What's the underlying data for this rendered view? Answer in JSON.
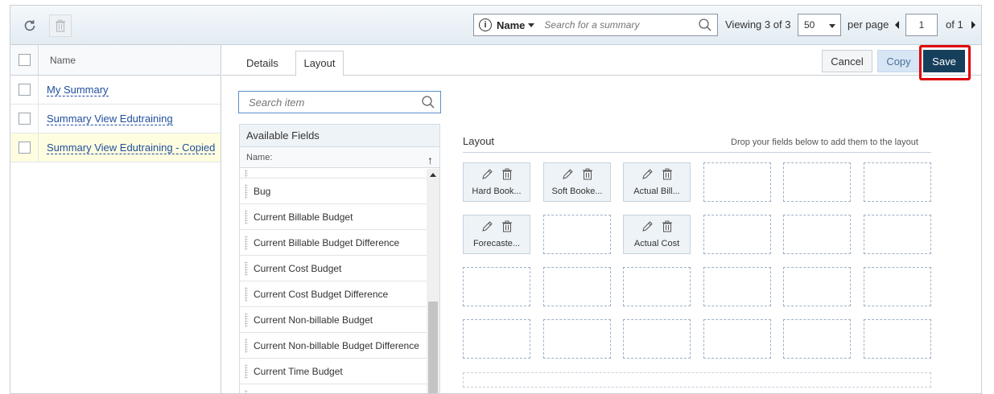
{
  "toolbar": {
    "search_field": "Name",
    "search_placeholder": "Search for a summary",
    "viewing_text": "Viewing 3 of 3",
    "per_page_value": "50",
    "per_page_label": "per page",
    "page_value": "1",
    "page_of": "of 1"
  },
  "list": {
    "column_header": "Name",
    "rows": [
      "My Summary",
      "Summary View Edutraining",
      "Summary View Edutraining - Copied"
    ]
  },
  "tabs": {
    "details": "Details",
    "layout": "Layout"
  },
  "actions": {
    "cancel": "Cancel",
    "copy": "Copy",
    "save": "Save"
  },
  "fields_panel": {
    "search_placeholder": "Search item",
    "title": "Available Fields",
    "column_header": "Name:",
    "items": [
      "Bug",
      "Current Billable Budget",
      "Current Billable Budget Difference",
      "Current Cost Budget",
      "Current Cost Budget Difference",
      "Current Non-billable Budget",
      "Current Non-billable Budget Difference",
      "Current Time Budget"
    ]
  },
  "layout": {
    "title": "Layout",
    "hint": "Drop your fields below to add them to the layout",
    "cards": [
      "Hard Book...",
      "Soft Booke...",
      "Actual Bill...",
      "Forecaste...",
      "Actual Cost"
    ]
  },
  "colors": {
    "save_bg": "#163f5c",
    "highlight": "#e00000",
    "link": "#1e4e9c",
    "selected_row": "#fffde0"
  }
}
